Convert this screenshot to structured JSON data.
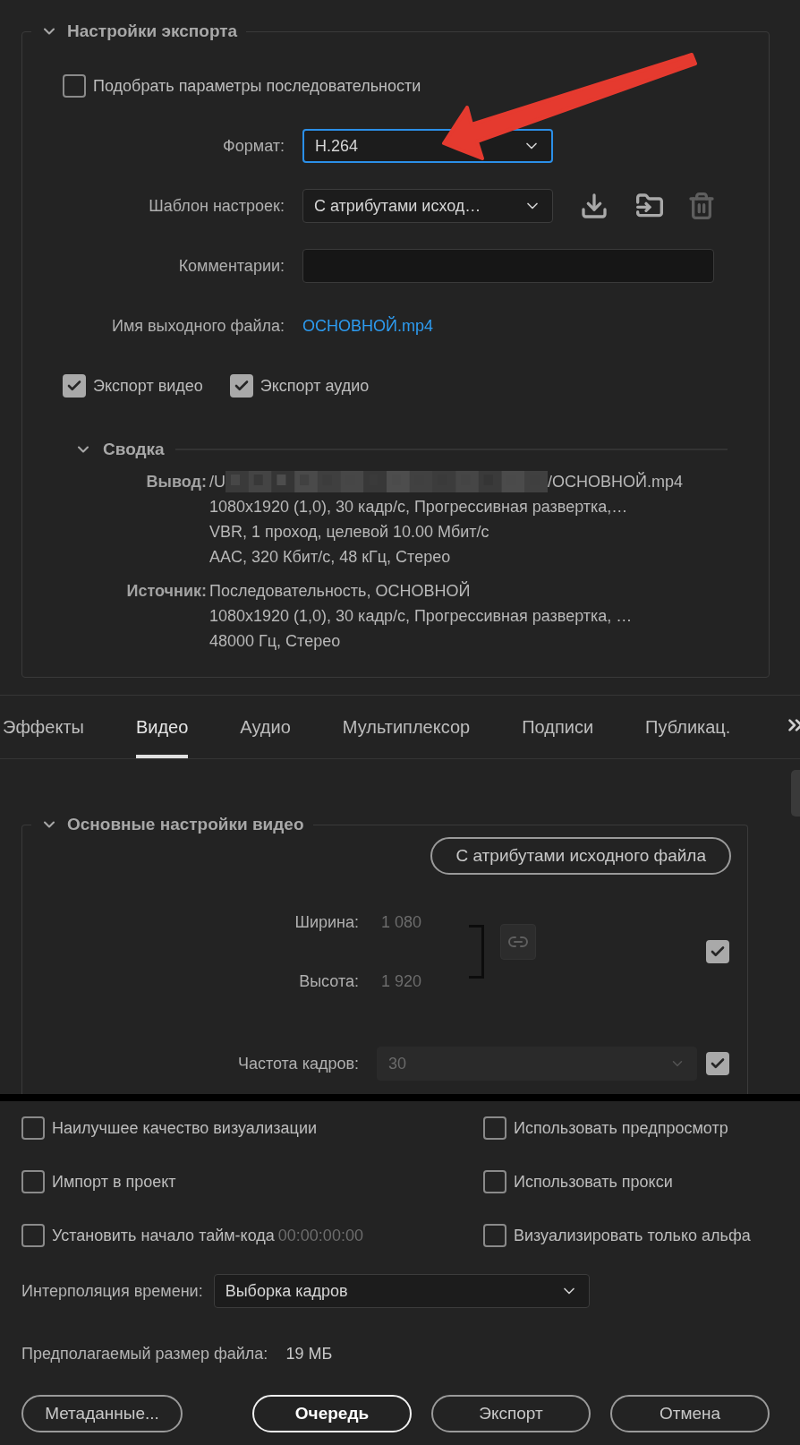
{
  "export_settings": {
    "title": "Настройки экспорта",
    "expanded": true,
    "match_sequence": {
      "label": "Подобрать параметры последовательности",
      "checked": false
    },
    "format": {
      "label": "Формат:",
      "value": "H.264",
      "focused": true
    },
    "preset": {
      "label": "Шаблон настроек:",
      "value": "С атрибутами исход…"
    },
    "comments": {
      "label": "Комментарии:"
    },
    "output_name": {
      "label": "Имя выходного файла:",
      "value": "ОСНОВНОЙ.mp4"
    },
    "export_video": {
      "label": "Экспорт видео",
      "checked": true
    },
    "export_audio": {
      "label": "Экспорт аудио",
      "checked": true
    },
    "summary": {
      "title": "Сводка",
      "expanded": true,
      "output": {
        "label": "Вывод:",
        "path_start": "/U",
        "path_end": "/ОСНОВНОЙ.mp4",
        "lines": [
          "1080x1920 (1,0), 30 кадр/с, Прогрессивная развертка,…",
          "VBR, 1 проход, целевой 10.00 Мбит/с",
          "AAC, 320 Кбит/с, 48 кГц, Стерео"
        ]
      },
      "source": {
        "label": "Источник:",
        "lines": [
          "Последовательность, ОСНОВНОЙ",
          "1080x1920 (1,0), 30 кадр/с, Прогрессивная развертка, …",
          "48000 Гц, Стерео"
        ]
      }
    }
  },
  "tabs": [
    {
      "label": "Эффекты",
      "selected": false
    },
    {
      "label": "Видео",
      "selected": true
    },
    {
      "label": "Аудио",
      "selected": false
    },
    {
      "label": "Мультиплексор",
      "selected": false
    },
    {
      "label": "Подписи",
      "selected": false
    },
    {
      "label": "Публикац.",
      "selected": false
    }
  ],
  "video": {
    "title": "Основные настройки видео",
    "expanded": true,
    "match_button": "С атрибутами исходного файла",
    "width": {
      "label": "Ширина:",
      "value": "1 080",
      "disabled": true
    },
    "height": {
      "label": "Высота:",
      "value": "1 920",
      "disabled": true
    },
    "match_dimensions": {
      "checked": true
    },
    "frame_rate": {
      "label": "Частота кадров:",
      "value": "30",
      "disabled": true
    },
    "match_frame_rate": {
      "checked": true
    }
  },
  "options": [
    {
      "label": "Наилучшее качество визуализации",
      "checked": false
    },
    {
      "label": "Использовать предпросмотр",
      "checked": false
    },
    {
      "label": "Импорт в проект",
      "checked": false
    },
    {
      "label": "Использовать прокси",
      "checked": false
    },
    {
      "label": "Установить начало тайм-кода",
      "checked": false,
      "value": "00:00:00:00"
    },
    {
      "label": "Визуализировать только альфа",
      "checked": false
    }
  ],
  "interpolation": {
    "label": "Интерполяция времени:",
    "value": "Выборка кадров"
  },
  "file_size": {
    "label": "Предполагаемый размер файла:",
    "value": "19 МБ"
  },
  "buttons": [
    {
      "label": "Метаданные...",
      "primary": false
    },
    {
      "label": "Очередь",
      "primary": true
    },
    {
      "label": "Экспорт",
      "primary": false
    },
    {
      "label": "Отмена",
      "primary": false
    }
  ]
}
